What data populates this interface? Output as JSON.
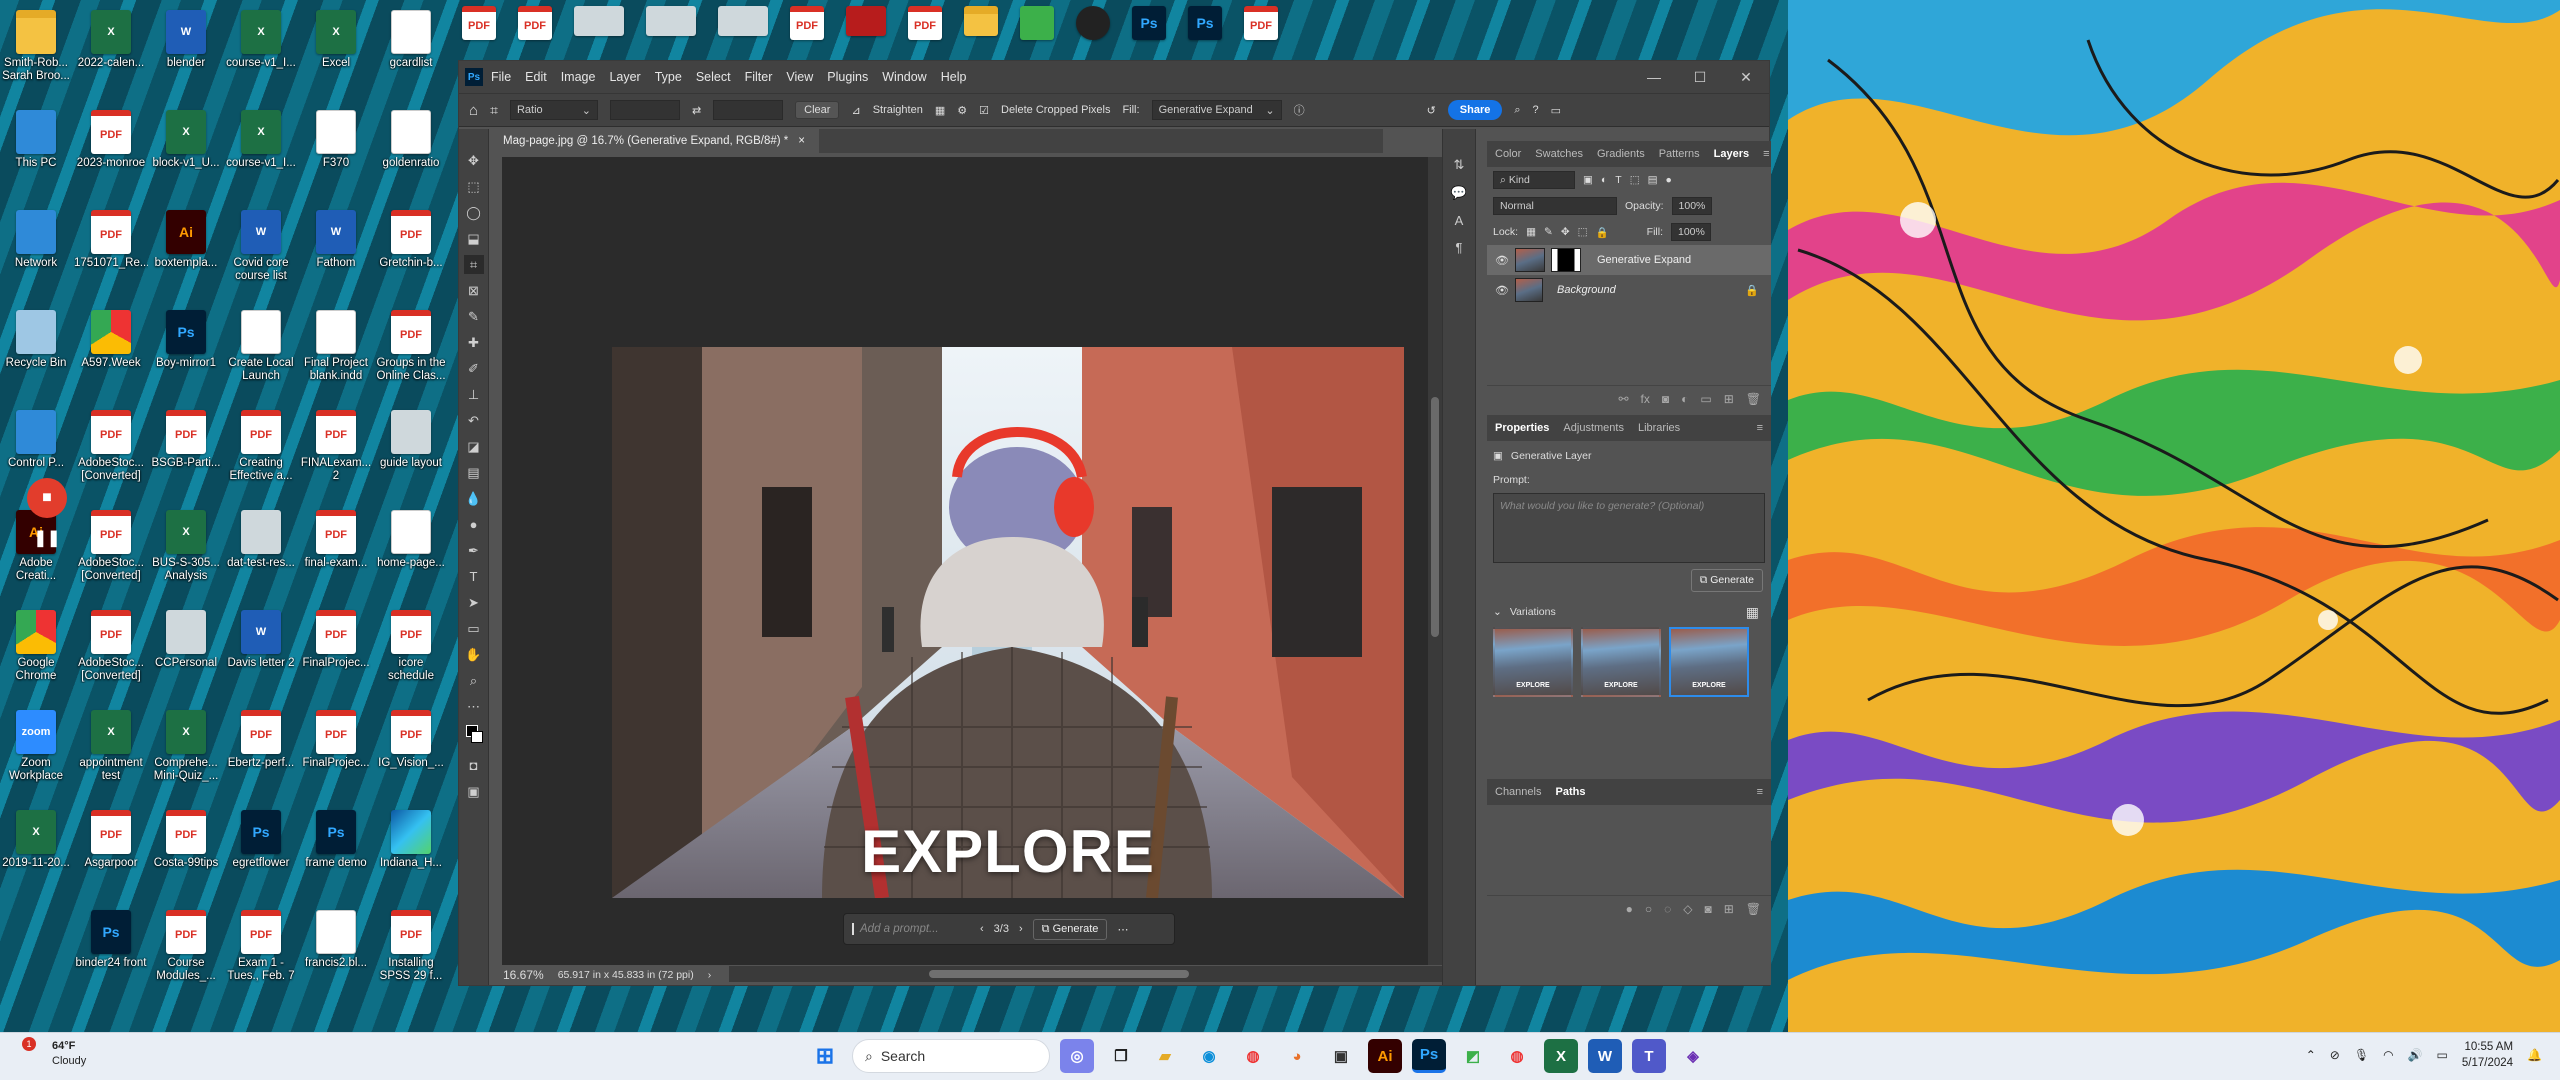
{
  "desktop": {
    "icons_col1": [
      {
        "label": "Smith-Rob... Sarah Broo...",
        "type": "folder"
      },
      {
        "label": "This PC",
        "type": "pc"
      },
      {
        "label": "Network",
        "type": "pc"
      },
      {
        "label": "Recycle Bin",
        "type": "recycle"
      },
      {
        "label": "Control P...",
        "type": "pc"
      },
      {
        "label": "Adobe Creati...",
        "type": "ai"
      },
      {
        "label": "Google Chrome",
        "type": "chrome"
      },
      {
        "label": "Zoom Workplace",
        "type": "zoom"
      },
      {
        "label": "2019-11-20...",
        "type": "xls"
      }
    ],
    "icons_col2": [
      {
        "label": "2022-calen...",
        "type": "xls"
      },
      {
        "label": "2023-monroe",
        "type": "pdf"
      },
      {
        "label": "1751071_Re...",
        "type": "pdf"
      },
      {
        "label": "A597.Week",
        "type": "chrome"
      },
      {
        "label": "AdobeStoc... [Converted]",
        "type": "pdf"
      },
      {
        "label": "AdobeStoc... [Converted]",
        "type": "pdf"
      },
      {
        "label": "AdobeStoc... [Converted]",
        "type": "pdf"
      },
      {
        "label": "appointment test",
        "type": "xls"
      },
      {
        "label": "Asgarpoor",
        "type": "pdf"
      },
      {
        "label": "binder24 front",
        "type": "ps"
      }
    ],
    "icons_col3": [
      {
        "label": "blender",
        "type": "word"
      },
      {
        "label": "block-v1_U...",
        "type": "xls"
      },
      {
        "label": "boxtempla...",
        "type": "ai"
      },
      {
        "label": "Boy-mirror1",
        "type": "ps"
      },
      {
        "label": "BSGB-Parti...",
        "type": "pdf"
      },
      {
        "label": "BUS-S-305... Analysis",
        "type": "xls"
      },
      {
        "label": "CCPersonal",
        "type": "win"
      },
      {
        "label": "Comprehe... Mini-Quiz_...",
        "type": "xls"
      },
      {
        "label": "Costa-99tips",
        "type": "pdf"
      },
      {
        "label": "Course Modules_...",
        "type": "pdf"
      }
    ],
    "icons_col4": [
      {
        "label": "course-v1_I...",
        "type": "xls"
      },
      {
        "label": "course-v1_I...",
        "type": "xls"
      },
      {
        "label": "Covid core course list",
        "type": "word"
      },
      {
        "label": "Create Local Launch",
        "type": "doc"
      },
      {
        "label": "Creating Effective a...",
        "type": "pdf"
      },
      {
        "label": "dat-test-res...",
        "type": "win"
      },
      {
        "label": "Davis letter 2",
        "type": "word"
      },
      {
        "label": "Ebertz-perf...",
        "type": "pdf"
      },
      {
        "label": "egretflower",
        "type": "ps"
      },
      {
        "label": "Exam 1 - Tues., Feb. 7",
        "type": "pdf"
      }
    ],
    "icons_col5": [
      {
        "label": "Excel",
        "type": "xls"
      },
      {
        "label": "F370",
        "type": "doc"
      },
      {
        "label": "Fathom",
        "type": "word"
      },
      {
        "label": "Final Project blank.indd",
        "type": "doc"
      },
      {
        "label": "FINALexam... 2",
        "type": "pdf"
      },
      {
        "label": "final-exam...",
        "type": "pdf"
      },
      {
        "label": "FinalProjec...",
        "type": "pdf"
      },
      {
        "label": "FinalProjec...",
        "type": "pdf"
      },
      {
        "label": "frame demo",
        "type": "ps"
      },
      {
        "label": "francis2.bl...",
        "type": "doc"
      }
    ],
    "icons_col6": [
      {
        "label": "gcardlist",
        "type": "doc"
      },
      {
        "label": "goldenratio",
        "type": "doc"
      },
      {
        "label": "Gretchin-b...",
        "type": "pdf"
      },
      {
        "label": "Groups in the Online Clas...",
        "type": "pdf"
      },
      {
        "label": "guide layout",
        "type": "win"
      },
      {
        "label": "home-page...",
        "type": "doc"
      },
      {
        "label": "icore schedule",
        "type": "pdf"
      },
      {
        "label": "IG_Vision_...",
        "type": "pdf"
      },
      {
        "label": "Indiana_H...",
        "type": "edge"
      },
      {
        "label": "Installing SPSS 29 f...",
        "type": "pdf"
      }
    ],
    "top_strip": [
      "PDF",
      "PDF",
      "",
      "",
      "",
      "PDF",
      "",
      "PDF",
      "",
      "",
      "",
      "Ps",
      "Ps",
      "PDF"
    ]
  },
  "photoshop": {
    "app_logo": "Ps",
    "menu": [
      "File",
      "Edit",
      "Image",
      "Layer",
      "Type",
      "Select",
      "Filter",
      "View",
      "Plugins",
      "Window",
      "Help"
    ],
    "options": {
      "ratio": "Ratio",
      "clear": "Clear",
      "straighten": "Straighten",
      "delete_cropped": "Delete Cropped Pixels",
      "fill_label": "Fill:",
      "fill_value": "Generative Expand",
      "share": "Share"
    },
    "doc_tab": "Mag-page.jpg @ 16.7% (Generative Expand, RGB/8#) *",
    "canvas_text": "EXPLORE",
    "contextual_bar": {
      "placeholder": "Add a prompt...",
      "counter": "3/3",
      "generate": "Generate"
    },
    "status": {
      "zoom": "16.67%",
      "doc_info": "65.917 in x 45.833 in (72 ppi)"
    },
    "layers_panel": {
      "tabs": [
        "Color",
        "Swatches",
        "Gradients",
        "Patterns",
        "Layers"
      ],
      "active_tab": "Layers",
      "filter": "Kind",
      "blend_mode": "Normal",
      "opacity_label": "Opacity:",
      "opacity": "100%",
      "lock_label": "Lock:",
      "fill_label": "Fill:",
      "fill": "100%",
      "layers": [
        {
          "name": "Generative Expand",
          "selected": true
        },
        {
          "name": "Background",
          "selected": false
        }
      ]
    },
    "properties_panel": {
      "tabs": [
        "Properties",
        "Adjustments",
        "Libraries"
      ],
      "active_tab": "Properties",
      "layer_type": "Generative Layer",
      "prompt_label": "Prompt:",
      "prompt_placeholder": "What would you like to generate? (Optional)",
      "generate": "Generate",
      "variations_label": "Variations",
      "variations": [
        "EXPLORE",
        "EXPLORE",
        "EXPLORE"
      ],
      "selected_variation": 3
    },
    "bottom_panel": {
      "tabs": [
        "Channels",
        "Paths"
      ],
      "active_tab": "Paths"
    }
  },
  "taskbar": {
    "weather_temp": "64°F",
    "weather_desc": "Cloudy",
    "weather_badge": "1",
    "search_label": "Search",
    "time": "10:55 AM",
    "date": "5/17/2024"
  }
}
